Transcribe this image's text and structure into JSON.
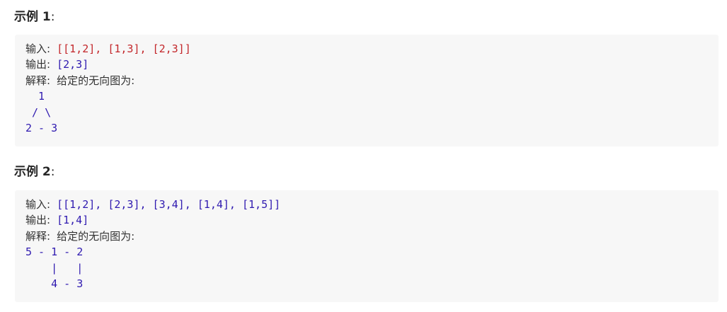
{
  "examples": [
    {
      "title": "示例 1",
      "colon": ":",
      "input_label": "输入:",
      "input_value": "[[1,2], [1,3], [2,3]]",
      "output_label": "输出:",
      "output_value": "[2,3]",
      "explain_label": "解释:",
      "explain_text": "给定的无向图为:",
      "graph_lines": [
        "  1",
        " / \\",
        "2 - 3"
      ]
    },
    {
      "title": "示例 2",
      "colon": ":",
      "input_label": "输入:",
      "input_value": "[[1,2], [2,3], [3,4], [1,4], [1,5]]",
      "output_label": "输出:",
      "output_value": "[1,4]",
      "explain_label": "解释:",
      "explain_text": "给定的无向图为:",
      "graph_lines": [
        "5 - 1 - 2",
        "    |   |",
        "    4 - 3"
      ]
    }
  ],
  "colors": {
    "number": "#2f1ab0",
    "string_highlight": "#c3272b",
    "block_background": "#f7f7f7",
    "text": "#333333"
  }
}
